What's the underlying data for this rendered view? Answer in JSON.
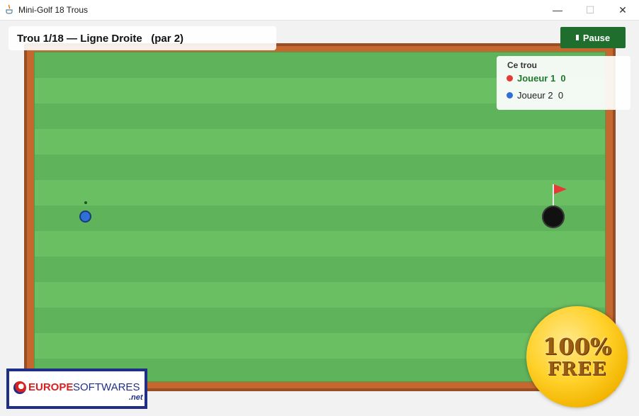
{
  "window": {
    "title": "Mini-Golf 18 Trous",
    "minimize_glyph": "—",
    "maximize_glyph": "☐",
    "close_glyph": "✕"
  },
  "hud": {
    "hole_info": "Trou 1/18 — Ligne Droite   (par 2)",
    "pause_label": "Pause"
  },
  "scorecard": {
    "title": "Ce trou",
    "players": [
      {
        "label": "Joueur 1  0",
        "color": "#e53935",
        "active": true
      },
      {
        "label": "Joueur 2  0",
        "color": "#2f6fd6",
        "active": false
      }
    ]
  },
  "course": {
    "ball_color": "#2f6fd6",
    "flag_color": "#e53935",
    "grass_colors": [
      "#5fb45b",
      "#6bbf63"
    ],
    "rail_color": "#c4682f"
  },
  "overlays": {
    "badge_line1": "100%",
    "badge_line2": "FREE",
    "logo_part1": "EUROPE",
    "logo_part2": "SOFTWARES",
    "logo_suffix": ".net"
  }
}
